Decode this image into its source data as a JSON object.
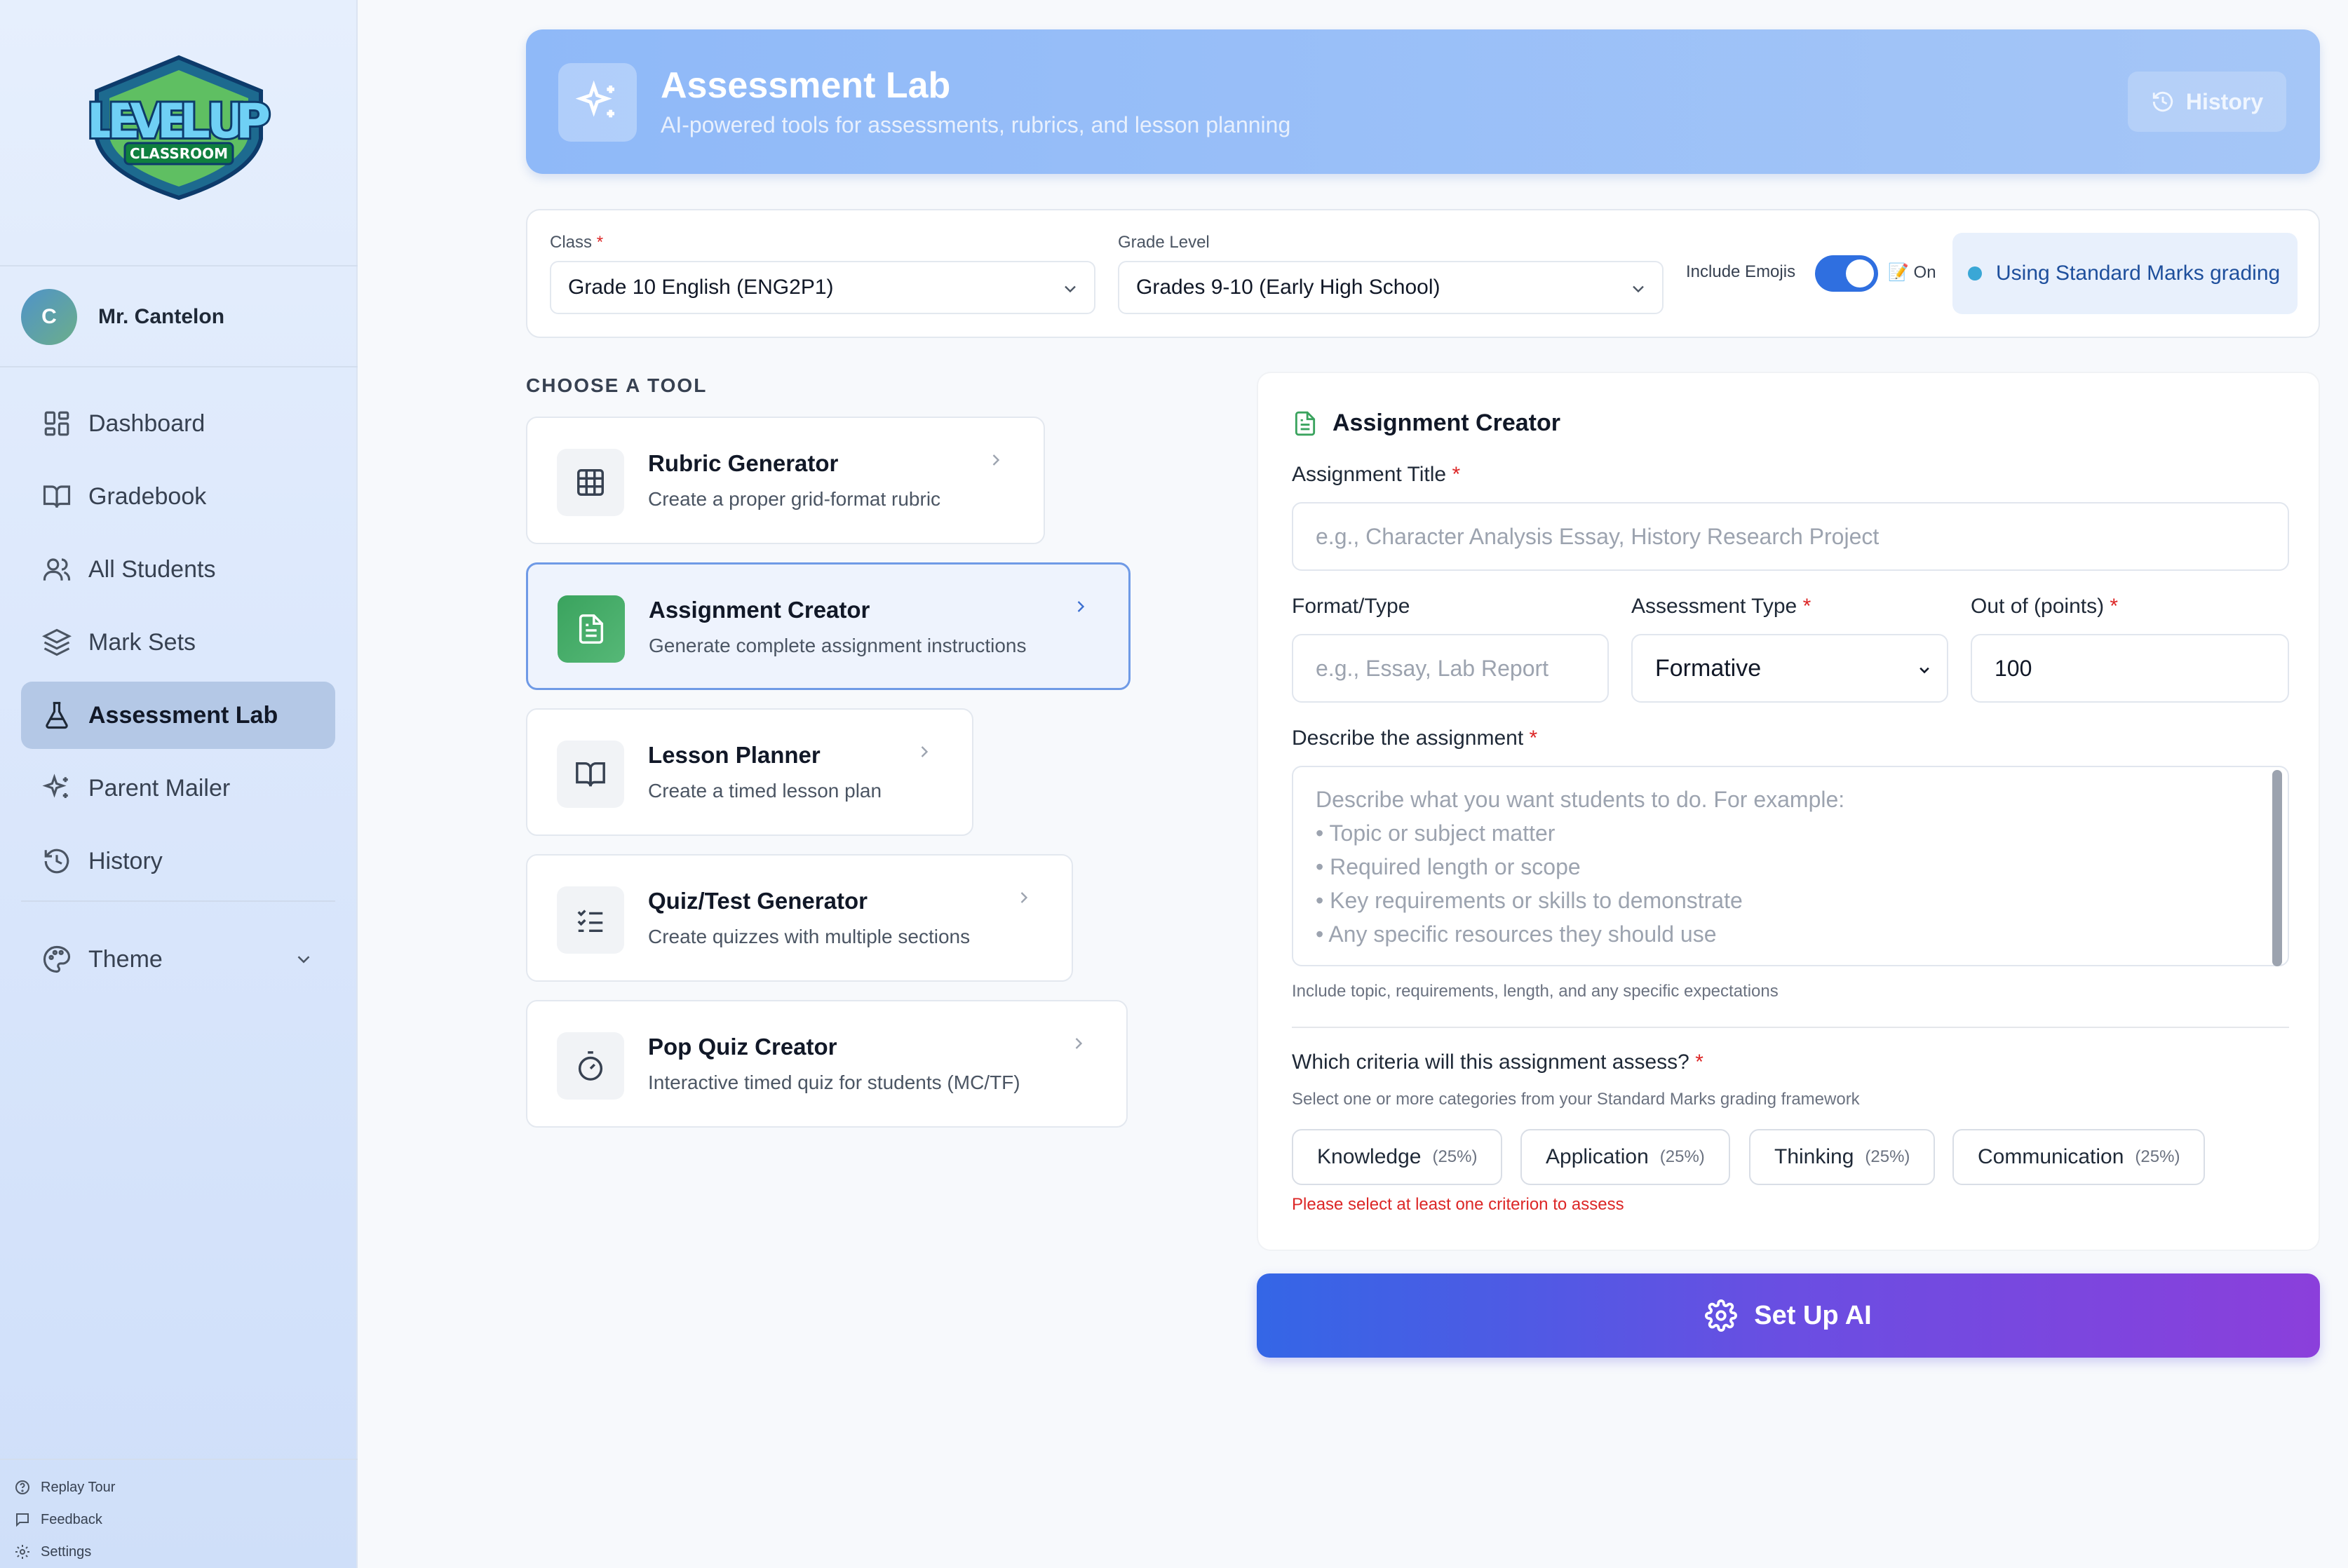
{
  "brand": {
    "logo_main": "LEVEL UP",
    "logo_sub": "CLASSROOM"
  },
  "user": {
    "initial": "C",
    "name": "Mr. Cantelon"
  },
  "nav": {
    "items": [
      {
        "label": "Dashboard",
        "icon": "layout-grid-icon"
      },
      {
        "label": "Gradebook",
        "icon": "book-open-icon"
      },
      {
        "label": "All Students",
        "icon": "users-icon"
      },
      {
        "label": "Mark Sets",
        "icon": "layers-icon"
      },
      {
        "label": "Assessment Lab",
        "icon": "flask-icon",
        "active": true
      },
      {
        "label": "Parent Mailer",
        "icon": "sparkles-icon"
      },
      {
        "label": "History",
        "icon": "history-icon"
      }
    ],
    "theme_label": "Theme"
  },
  "footer_links": {
    "replay_tour": "Replay Tour",
    "feedback": "Feedback",
    "settings": "Settings"
  },
  "header": {
    "title": "Assessment Lab",
    "subtitle": "AI-powered tools for assessments, rubrics, and lesson planning",
    "history_button": "History"
  },
  "filters": {
    "class_label": "Class",
    "class_value": "Grade 10 English (ENG2P1)",
    "grade_label": "Grade Level",
    "grade_value": "Grades 9-10 (Early High School)",
    "emoji_label": "Include Emojis",
    "emoji_state": "📝 On",
    "emoji_enabled": true,
    "grading_note": "Using Standard Marks grading"
  },
  "tools": {
    "heading": "CHOOSE A TOOL",
    "items": [
      {
        "title": "Rubric Generator",
        "desc": "Create a proper grid-format rubric",
        "icon": "grid-icon"
      },
      {
        "title": "Assignment Creator",
        "desc": "Generate complete assignment instructions",
        "icon": "document-icon",
        "active": true
      },
      {
        "title": "Lesson Planner",
        "desc": "Create a timed lesson plan",
        "icon": "book-open-icon"
      },
      {
        "title": "Quiz/Test Generator",
        "desc": "Create quizzes with multiple sections",
        "icon": "list-checks-icon"
      },
      {
        "title": "Pop Quiz Creator",
        "desc": "Interactive timed quiz for students (MC/TF)",
        "icon": "timer-icon"
      }
    ]
  },
  "form": {
    "title": "Assignment Creator",
    "assignment_title_label": "Assignment Title",
    "assignment_title_placeholder": "e.g., Character Analysis Essay, History Research Project",
    "format_label": "Format/Type",
    "format_placeholder": "e.g., Essay, Lab Report",
    "assessment_type_label": "Assessment Type",
    "assessment_type_value": "Formative",
    "points_label": "Out of (points)",
    "points_value": "100",
    "describe_label": "Describe the assignment",
    "describe_placeholder": [
      "Describe what you want students to do. For example:",
      "• Topic or subject matter",
      "• Required length or scope",
      "• Key requirements or skills to demonstrate",
      "• Any specific resources they should use"
    ],
    "describe_hint": "Include topic, requirements, length, and any specific expectations",
    "criteria_label": "Which criteria will this assignment assess?",
    "criteria_hint": "Select one or more categories from your Standard Marks grading framework",
    "criteria": [
      {
        "label": "Knowledge",
        "pct": "(25%)"
      },
      {
        "label": "Application",
        "pct": "(25%)"
      },
      {
        "label": "Thinking",
        "pct": "(25%)"
      },
      {
        "label": "Communication",
        "pct": "(25%)"
      }
    ],
    "criteria_error": "Please select at least one criterion to assess",
    "required_mark": "*"
  },
  "cta": {
    "label": "Set Up AI"
  }
}
